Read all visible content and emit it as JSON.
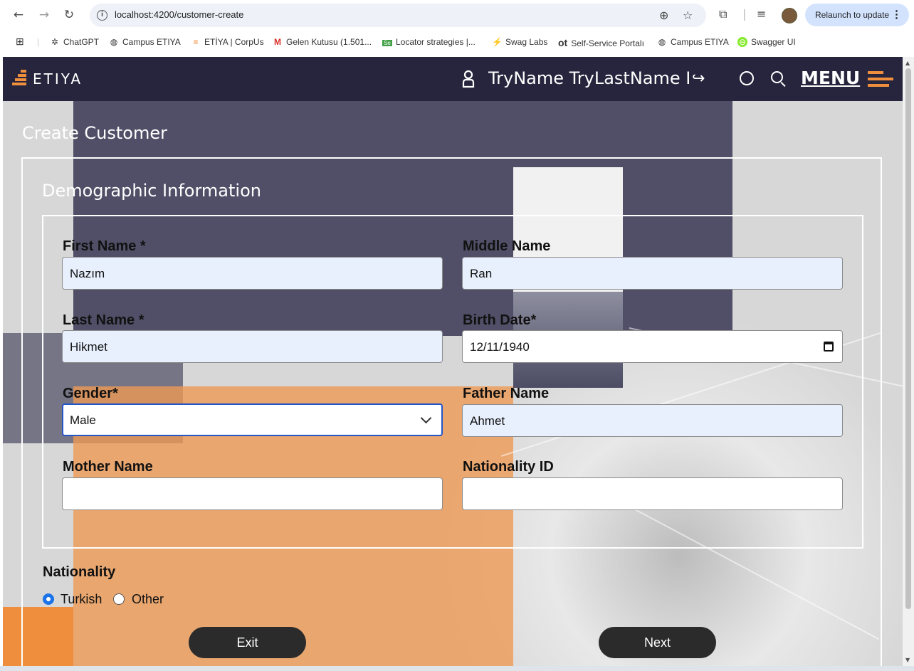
{
  "browser": {
    "url": "localhost:4200/customer-create",
    "relaunch_label": "Relaunch to update",
    "bookmarks": [
      "ChatGPT",
      "Campus ETIYA",
      "ETİYA | CorpUs",
      "Gelen Kutusu (1.501...",
      "Locator strategies |...",
      "Swag Labs",
      "Self-Service Portalı",
      "Campus ETIYA",
      "Swagger UI"
    ],
    "bookmark_prefix_ot": "ot"
  },
  "navbar": {
    "brand": "ETIYA",
    "user_name": "TryName TryLastName I",
    "menu_label": "MENU",
    "accent_color": "#ef8f3d",
    "bg_color": "#26253d"
  },
  "page": {
    "title": "Create Customer",
    "section_title": "Demographic Information"
  },
  "form": {
    "first_name": {
      "label": "First Name *",
      "value": "Nazım"
    },
    "middle_name": {
      "label": "Middle Name",
      "value": "Ran"
    },
    "last_name": {
      "label": "Last Name *",
      "value": "Hikmet"
    },
    "birth_date": {
      "label": "Birth Date*",
      "value": "12/11/1940"
    },
    "gender": {
      "label": "Gender*",
      "value": "Male"
    },
    "father_name": {
      "label": "Father Name",
      "value": "Ahmet"
    },
    "mother_name": {
      "label": "Mother Name",
      "value": ""
    },
    "nationality_id": {
      "label": "Nationality ID",
      "value": ""
    },
    "nationality": {
      "label": "Nationality",
      "options": [
        "Turkish",
        "Other"
      ],
      "selected": "Turkish"
    }
  },
  "buttons": {
    "exit": "Exit",
    "next": "Next"
  }
}
